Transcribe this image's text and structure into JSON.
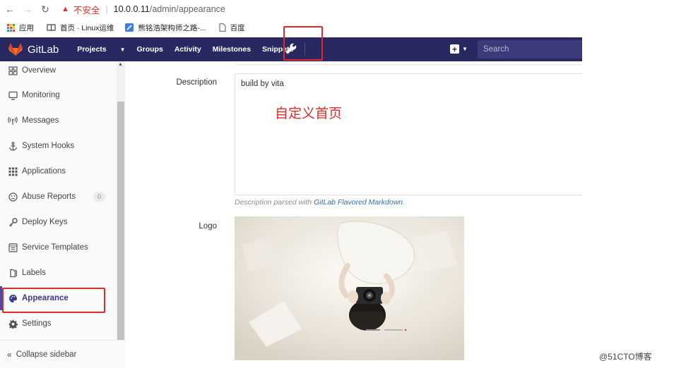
{
  "browser": {
    "insecure_label": "不安全",
    "url_host": "10.0.0.11",
    "url_path": "/admin/appearance",
    "bookmarks": [
      {
        "label": "应用",
        "icon": "apps-grid-icon"
      },
      {
        "label": "首页 · Linux运维",
        "icon": "book-icon"
      },
      {
        "label": "熊铭浩架构师之路-...",
        "icon": "blue-square-icon"
      },
      {
        "label": "百度",
        "icon": "page-icon"
      }
    ]
  },
  "header": {
    "brand": "GitLab",
    "nav": [
      "Projects",
      "Groups",
      "Activity",
      "Milestones",
      "Snippets"
    ],
    "search_placeholder": "Search",
    "accent": "#292961"
  },
  "sidebar": {
    "items": [
      {
        "label": "Overview",
        "icon": "grid-icon"
      },
      {
        "label": "Monitoring",
        "icon": "monitor-icon"
      },
      {
        "label": "Messages",
        "icon": "broadcast-icon"
      },
      {
        "label": "System Hooks",
        "icon": "anchor-icon"
      },
      {
        "label": "Applications",
        "icon": "apps-icon"
      },
      {
        "label": "Abuse Reports",
        "icon": "frown-icon",
        "badge": "0"
      },
      {
        "label": "Deploy Keys",
        "icon": "key-icon"
      },
      {
        "label": "Service Templates",
        "icon": "template-icon"
      },
      {
        "label": "Labels",
        "icon": "label-icon"
      },
      {
        "label": "Appearance",
        "icon": "palette-icon",
        "active": true
      },
      {
        "label": "Settings",
        "icon": "gear-icon"
      }
    ],
    "collapse_label": "Collapse sidebar"
  },
  "form": {
    "description_label": "Description",
    "description_value": "build by vita",
    "annotation": "自定义首页",
    "help_prefix": "Description parsed with ",
    "help_link": "GitLab Flavored Markdown",
    "help_suffix": ".",
    "logo_label": "Logo"
  },
  "watermark": "@51CTO博客",
  "colors": {
    "highlight": "#e02a2a",
    "link": "#2e6fb4"
  }
}
